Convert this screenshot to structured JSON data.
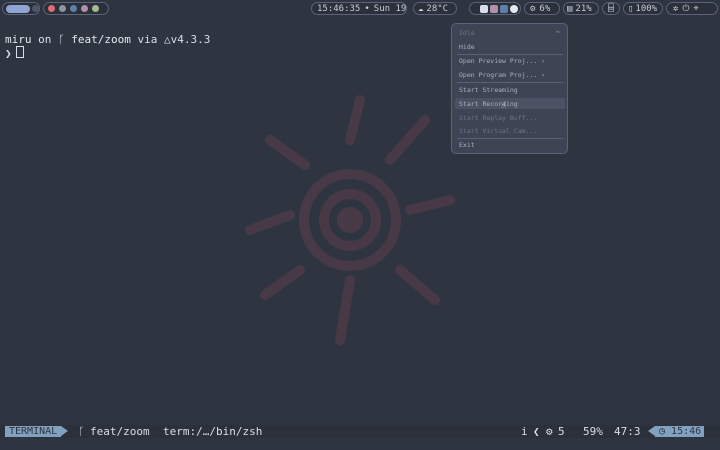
{
  "topbar": {
    "clock": "15:46:35",
    "date": "Sun 19",
    "weather": "28°C",
    "cpu": "6%",
    "mem": "21%",
    "battery": "100%",
    "colors": {
      "accent": "#8fa4d4",
      "border": "#5a6377"
    }
  },
  "terminal": {
    "user": "miru",
    "on": "on",
    "branch_icon": "git-branch-icon",
    "branch": "feat/zoom",
    "via": "via",
    "runtime_icon": "triangle-icon",
    "version": "v4.3.3",
    "prompt": "❯"
  },
  "menu": {
    "items": [
      {
        "label": "Idle",
        "disabled": true
      },
      {
        "label": "Hide",
        "disabled": false
      },
      {
        "label": "Open Preview Proj... ›",
        "disabled": false
      },
      {
        "label": "Open Program Proj... ›",
        "disabled": false
      },
      {
        "label": "Start Streaming",
        "disabled": false
      },
      {
        "label": "Start Recording",
        "disabled": false
      },
      {
        "label": "Start Replay Buff...",
        "disabled": true
      },
      {
        "label": "Start Virtual Cam...",
        "disabled": true
      },
      {
        "label": "Exit",
        "disabled": false
      }
    ]
  },
  "statusline": {
    "mode": "TERMINAL",
    "branch": "feat/zoom",
    "file": "term:/…/bin/zsh",
    "info": "i",
    "lsp_count": "5",
    "percent": "59%",
    "position": "47:3",
    "time": "15:46"
  }
}
